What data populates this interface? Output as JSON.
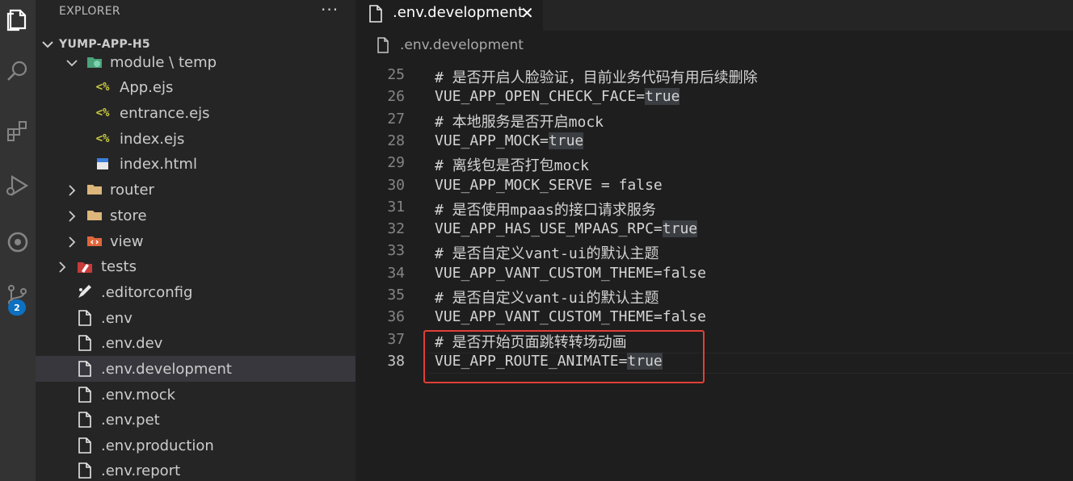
{
  "sidebar": {
    "title": "EXPLORER",
    "more": "···",
    "section": "YUMP-APP-H5",
    "items": [
      {
        "label": "module \\ temp",
        "kind": "folder-special",
        "expanded": true
      },
      {
        "label": "App.ejs",
        "kind": "ejs"
      },
      {
        "label": "entrance.ejs",
        "kind": "ejs"
      },
      {
        "label": "index.ejs",
        "kind": "ejs"
      },
      {
        "label": "index.html",
        "kind": "html"
      },
      {
        "label": "router",
        "kind": "folder"
      },
      {
        "label": "store",
        "kind": "folder"
      },
      {
        "label": "view",
        "kind": "folder-view"
      },
      {
        "label": "tests",
        "kind": "folder-tests"
      },
      {
        "label": ".editorconfig",
        "kind": "editorconfig"
      },
      {
        "label": ".env",
        "kind": "file"
      },
      {
        "label": ".env.dev",
        "kind": "file"
      },
      {
        "label": ".env.development",
        "kind": "file",
        "selected": true
      },
      {
        "label": ".env.mock",
        "kind": "file"
      },
      {
        "label": ".env.pet",
        "kind": "file"
      },
      {
        "label": ".env.production",
        "kind": "file"
      },
      {
        "label": ".env.report",
        "kind": "file"
      }
    ]
  },
  "activity": {
    "scm_badge": "2",
    "icons": [
      "files-icon",
      "search-icon",
      "extensions-icon",
      "run-debug-icon",
      "remote-icon",
      "source-control-icon"
    ]
  },
  "tab": {
    "label": ".env.development",
    "close": "✕"
  },
  "breadcrumb": {
    "label": ".env.development"
  },
  "editor": {
    "lines": [
      {
        "n": "25",
        "segments": [
          {
            "t": "# 是否开启人脸验证，目前业务代码有用后续删除"
          }
        ]
      },
      {
        "n": "26",
        "segments": [
          {
            "t": "VUE_APP_OPEN_CHECK_FACE="
          },
          {
            "t": "true",
            "hl": true
          }
        ]
      },
      {
        "n": "27",
        "segments": [
          {
            "t": "# 本地服务是否开启mock"
          }
        ]
      },
      {
        "n": "28",
        "segments": [
          {
            "t": "VUE_APP_MOCK="
          },
          {
            "t": "true",
            "hl": true
          }
        ]
      },
      {
        "n": "29",
        "segments": [
          {
            "t": "# 离线包是否打包mock"
          }
        ]
      },
      {
        "n": "30",
        "segments": [
          {
            "t": "VUE_APP_MOCK_SERVE = false"
          }
        ]
      },
      {
        "n": "31",
        "segments": [
          {
            "t": "# 是否使用mpaas的接口请求服务"
          }
        ]
      },
      {
        "n": "32",
        "segments": [
          {
            "t": "VUE_APP_HAS_USE_MPAAS_RPC="
          },
          {
            "t": "true",
            "hl": true
          }
        ]
      },
      {
        "n": "33",
        "segments": [
          {
            "t": "# 是否自定义vant-ui的默认主题"
          }
        ]
      },
      {
        "n": "34",
        "segments": [
          {
            "t": "VUE_APP_VANT_CUSTOM_THEME=false"
          }
        ]
      },
      {
        "n": "35",
        "segments": [
          {
            "t": "# 是否自定义vant-ui的默认主题"
          }
        ]
      },
      {
        "n": "36",
        "segments": [
          {
            "t": "VUE_APP_VANT_CUSTOM_THEME=false"
          }
        ]
      },
      {
        "n": "37",
        "segments": [
          {
            "t": "# 是否开始页面跳转转场动画"
          }
        ]
      },
      {
        "n": "38",
        "segments": [
          {
            "t": "VUE_APP_ROUTE_ANIMATE="
          },
          {
            "t": "true",
            "hl": true
          }
        ],
        "active": true
      }
    ]
  },
  "colors": {
    "highlight_box": "#e23f36",
    "badge": "#0e70c0"
  }
}
